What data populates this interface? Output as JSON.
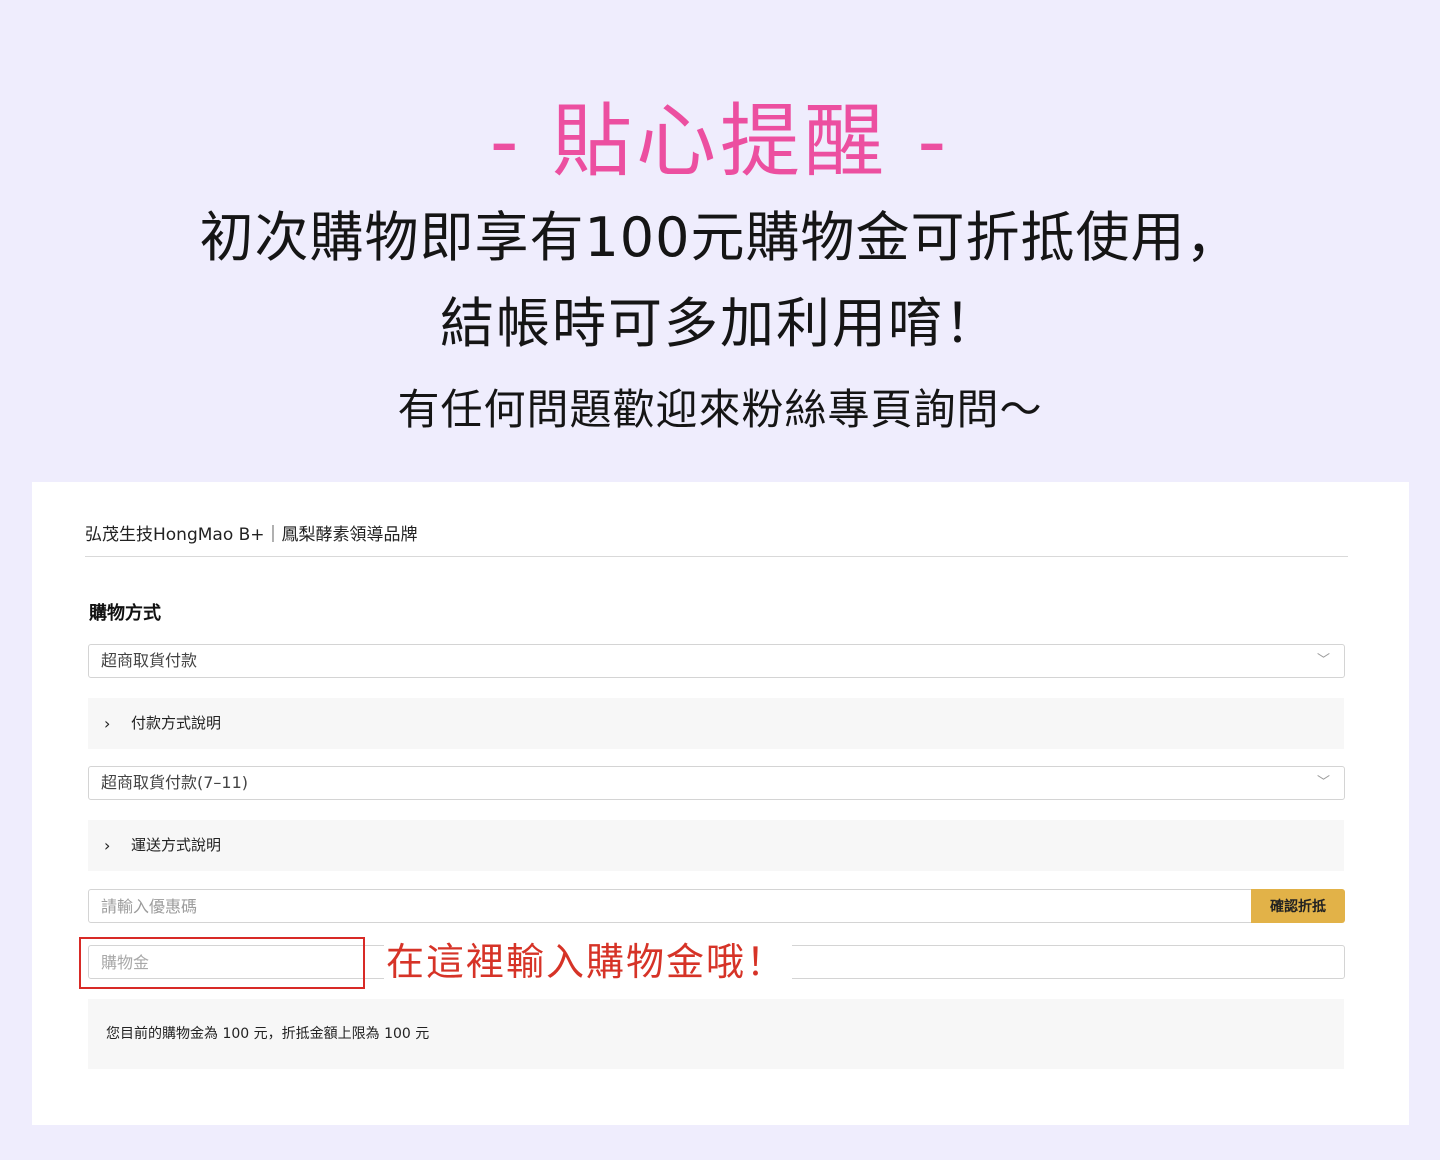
{
  "banner": {
    "title": "- 貼心提醒 -",
    "line1": "初次購物即享有100元購物金可折抵使用，",
    "line2": "結帳時可多加利用唷！",
    "line3": "有任何問題歡迎來粉絲專頁詢問～"
  },
  "checkout": {
    "store_name": "弘茂生技HongMao B+｜鳳梨酵素領導品牌",
    "shopping_method_label": "購物方式",
    "payment_select_value": "超商取貨付款",
    "payment_info_label": "付款方式說明",
    "shipping_select_value": "超商取貨付款(7–11)",
    "shipping_info_label": "運送方式說明",
    "coupon_placeholder": "請輸入優惠碼",
    "coupon_button": "確認折抵",
    "credit_placeholder": "購物金",
    "credit_hint": "在這裡輸入購物金哦！",
    "credit_info": "您目前的購物金為 100 元，折抵金額上限為 100 元"
  },
  "icons": {
    "select_chevron": "chevron-down-icon",
    "accordion_arrow": "chevron-right-icon"
  },
  "colors": {
    "page_background": "#efedfd",
    "title_pink": "#ec4fa0",
    "button_gold": "#e2b248",
    "hint_red": "#d63327"
  }
}
